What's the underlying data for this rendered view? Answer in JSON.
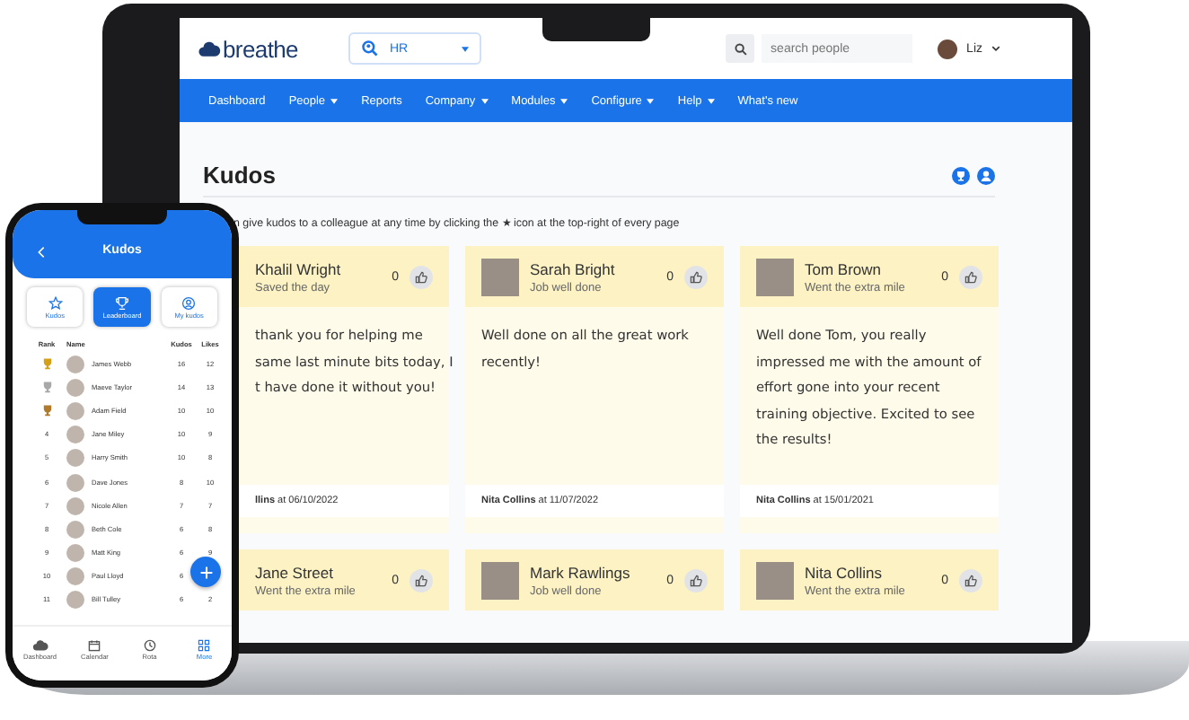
{
  "laptop": {
    "logo": "breathe",
    "workspace": "HR",
    "search": {
      "placeholder": "search people"
    },
    "user": "Liz",
    "nav": [
      {
        "label": "Dashboard",
        "menu": false
      },
      {
        "label": "People",
        "menu": true
      },
      {
        "label": "Reports",
        "menu": false
      },
      {
        "label": "Company",
        "menu": true
      },
      {
        "label": "Modules",
        "menu": true
      },
      {
        "label": "Configure",
        "menu": true
      },
      {
        "label": "Help",
        "menu": true
      },
      {
        "label": "What's new",
        "menu": false
      }
    ],
    "page_title": "Kudos",
    "intro": "n give kudos to a colleague at any time by clicking the ★ icon at the top-right of every page",
    "cards": [
      {
        "name": "Khalil Wright",
        "reason": "Saved the day",
        "count": "0",
        "photo": false,
        "lines": [
          "thank you for helping me",
          "same last minute bits today, I",
          "t have done it without you!"
        ],
        "footer": "**llins** at 06/10/2022"
      },
      {
        "name": "Sarah Bright",
        "reason": "Job well done",
        "count": "0",
        "photo": true,
        "lines": [
          "Well done on all the great work",
          "recently!"
        ],
        "footer": "**Nita Collins** at 11/07/2022"
      },
      {
        "name": "Tom Brown",
        "reason": "Went the extra mile",
        "count": "0",
        "photo": true,
        "lines": [
          "Well done Tom, you really",
          "impressed me with the amount of",
          "effort gone into your recent",
          "training objective. Excited to see",
          "the results!"
        ],
        "footer": "**Nita Collins** at 15/01/2021"
      },
      {
        "name": "Jane Street",
        "reason": "Went the extra mile",
        "count": "0",
        "photo": false
      },
      {
        "name": "Mark Rawlings",
        "reason": "Job well done",
        "count": "0",
        "photo": true
      },
      {
        "name": "Nita Collins",
        "reason": "Went the extra mile",
        "count": "0",
        "photo": true
      }
    ]
  },
  "phone": {
    "title": "Kudos",
    "tabs": [
      {
        "label": "Kudos",
        "selected": false
      },
      {
        "label": "Leaderboard",
        "selected": true
      },
      {
        "label": "My kudos",
        "selected": false
      }
    ],
    "columns": [
      "Rank",
      "Name",
      "Kudos",
      "Likes"
    ],
    "rows": [
      {
        "color": "#d4a017",
        "name": "James Webb",
        "kudos": "16",
        "likes": "12"
      },
      {
        "color": "#a8a8a8",
        "name": "Maeve Taylor",
        "kudos": "14",
        "likes": "13"
      },
      {
        "color": "#b07a2a",
        "name": "Adam Field",
        "kudos": "10",
        "likes": "10"
      },
      {
        "rank": "4",
        "name": "Jane Miley",
        "kudos": "10",
        "likes": "9"
      },
      {
        "rank": "5",
        "name": "Harry Smith",
        "kudos": "10",
        "likes": "8"
      },
      {
        "rank": "6",
        "name": "Dave Jones",
        "kudos": "8",
        "likes": "10"
      },
      {
        "rank": "7",
        "name": "Nicole Allen",
        "kudos": "7",
        "likes": "7"
      },
      {
        "rank": "8",
        "name": "Beth Cole",
        "kudos": "6",
        "likes": "8"
      },
      {
        "rank": "9",
        "name": "Matt King",
        "kudos": "6",
        "likes": "9"
      },
      {
        "rank": "10",
        "name": "Paul Lloyd",
        "kudos": "6"
      },
      {
        "rank": "11",
        "name": "Bill Tulley",
        "kudos": "6",
        "likes": "2"
      }
    ],
    "nav": [
      {
        "label": "Dashboard",
        "selected": false
      },
      {
        "label": "Calendar",
        "selected": false
      },
      {
        "label": "Rota",
        "selected": false
      },
      {
        "label": "More",
        "selected": true
      }
    ]
  }
}
